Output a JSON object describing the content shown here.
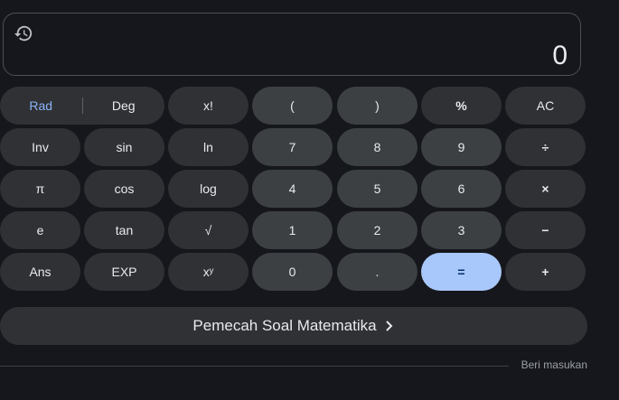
{
  "display": {
    "value": "0",
    "history_icon": "history-icon"
  },
  "angle_mode": {
    "rad_label": "Rad",
    "deg_label": "Deg"
  },
  "keys": {
    "factorial": "x!",
    "open_paren": "(",
    "close_paren": ")",
    "percent": "%",
    "clear": "AC",
    "inv": "Inv",
    "sin": "sin",
    "ln": "ln",
    "seven": "7",
    "eight": "8",
    "nine": "9",
    "divide": "÷",
    "pi": "π",
    "cos": "cos",
    "log": "log",
    "four": "4",
    "five": "5",
    "six": "6",
    "multiply": "×",
    "e": "e",
    "tan": "tan",
    "sqrt": "√",
    "one": "1",
    "two": "2",
    "three": "3",
    "minus": "−",
    "ans": "Ans",
    "exp": "EXP",
    "power": "xʸ",
    "zero": "0",
    "dot": ".",
    "equals": "=",
    "plus": "+"
  },
  "solver": {
    "label": "Pemecah Soal Matematika"
  },
  "footer": {
    "feedback_label": "Beri masukan"
  },
  "colors": {
    "background": "#16171c",
    "key": "#303134",
    "number_key": "#3c4043",
    "equals_key": "#a8c7fa",
    "rad_active": "#8ab4f8"
  }
}
